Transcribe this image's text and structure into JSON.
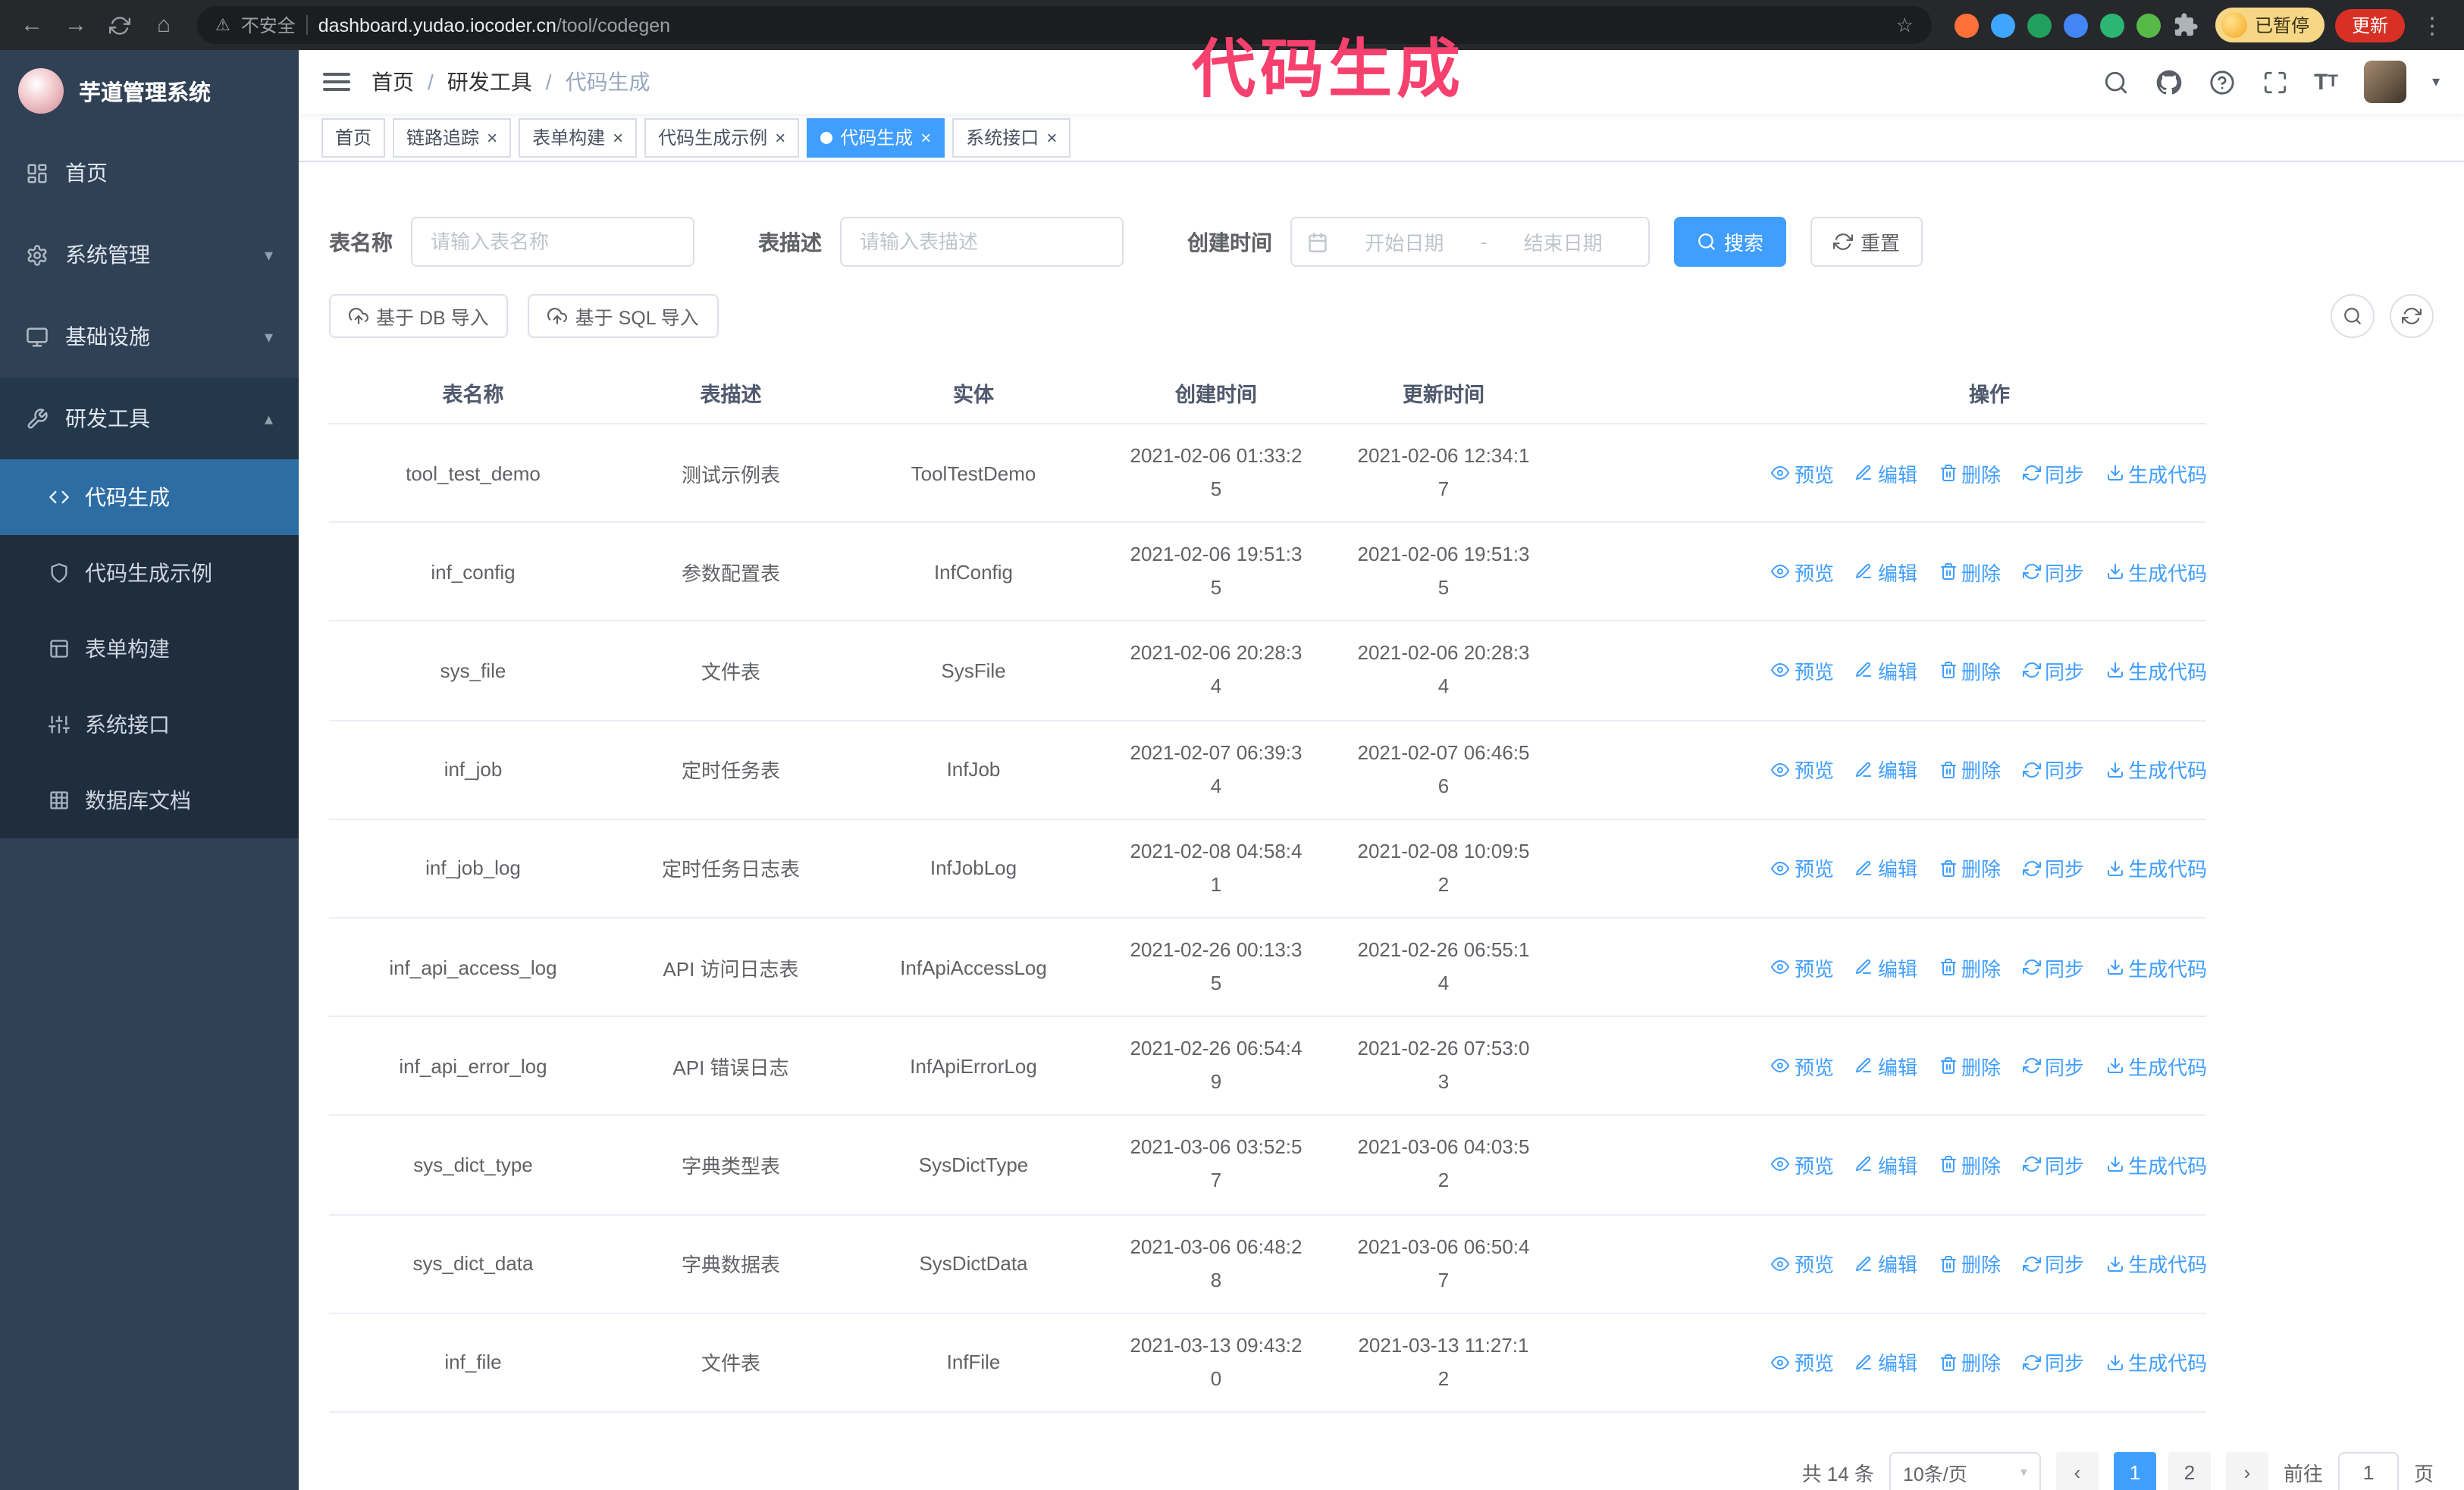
{
  "colors": {
    "primary": "#409eff",
    "sidebar_bg": "#304156",
    "overlay_text": "#f6406e"
  },
  "browser": {
    "security_label": "不安全",
    "url_host": "dashboard.yudao.iocoder.cn",
    "url_path": "/tool/codegen",
    "paused_badge": "已暂停",
    "update_button": "更新",
    "extensions": [
      {
        "name": "fox-extension-icon",
        "color": "#ff7139",
        "type": "dot"
      },
      {
        "name": "drop-extension-icon",
        "color": "#3ea6ff",
        "type": "dot"
      },
      {
        "name": "check-extension-icon",
        "color": "#21a05d",
        "type": "dot"
      },
      {
        "name": "people-extension-icon",
        "color": "#4285f4",
        "type": "dot"
      },
      {
        "name": "stripes-extension-icon",
        "color": "#2bb673",
        "type": "dot"
      },
      {
        "name": "leaf-extension-icon",
        "color": "#57b947",
        "type": "dot"
      },
      {
        "name": "puzzle-extension-icon",
        "color": "#9aa0a6",
        "type": "puzzle"
      }
    ]
  },
  "overlay_title": {
    "text": "代码生成"
  },
  "sidebar": {
    "logo_title": "芋道管理系统",
    "items": [
      {
        "id": "home",
        "label": "首页",
        "icon": "home",
        "expandable": false,
        "expanded": false
      },
      {
        "id": "system",
        "label": "系统管理",
        "icon": "gear",
        "expandable": true,
        "expanded": false
      },
      {
        "id": "infra",
        "label": "基础设施",
        "icon": "monitor",
        "expandable": true,
        "expanded": false
      },
      {
        "id": "devtools",
        "label": "研发工具",
        "icon": "wrench",
        "expandable": true,
        "expanded": true
      }
    ],
    "submenu": [
      {
        "id": "codegen",
        "label": "代码生成",
        "icon": "code",
        "active": true
      },
      {
        "id": "codegen-demo",
        "label": "代码生成示例",
        "icon": "shield",
        "active": false
      },
      {
        "id": "form-builder",
        "label": "表单构建",
        "icon": "form",
        "active": false
      },
      {
        "id": "api",
        "label": "系统接口",
        "icon": "api",
        "active": false
      },
      {
        "id": "db-doc",
        "label": "数据库文档",
        "icon": "db",
        "active": false
      }
    ]
  },
  "header": {
    "breadcrumb": [
      "首页",
      "研发工具",
      "代码生成"
    ]
  },
  "tabs": [
    {
      "id": "home",
      "label": "首页",
      "closable": false,
      "active": false
    },
    {
      "id": "tracing",
      "label": "链路追踪",
      "closable": true,
      "active": false
    },
    {
      "id": "form-builder",
      "label": "表单构建",
      "closable": true,
      "active": false
    },
    {
      "id": "codegen-demo",
      "label": "代码生成示例",
      "closable": true,
      "active": false
    },
    {
      "id": "codegen",
      "label": "代码生成",
      "closable": true,
      "active": true
    },
    {
      "id": "api",
      "label": "系统接口",
      "closable": true,
      "active": false
    }
  ],
  "filters": {
    "table_name_label": "表名称",
    "table_name_placeholder": "请输入表名称",
    "table_desc_label": "表描述",
    "table_desc_placeholder": "请输入表描述",
    "create_time_label": "创建时间",
    "date_start_placeholder": "开始日期",
    "date_separator": "-",
    "date_end_placeholder": "结束日期",
    "search_button": "搜索",
    "reset_button": "重置"
  },
  "toolbar": {
    "import_db_button": "基于 DB 导入",
    "import_sql_button": "基于 SQL 导入"
  },
  "table": {
    "columns": [
      "表名称",
      "表描述",
      "实体",
      "创建时间",
      "更新时间",
      "操作"
    ],
    "actions": [
      {
        "id": "preview",
        "label": "预览",
        "icon": "eye"
      },
      {
        "id": "edit",
        "label": "编辑",
        "icon": "edit"
      },
      {
        "id": "delete",
        "label": "删除",
        "icon": "trash"
      },
      {
        "id": "sync",
        "label": "同步",
        "icon": "sync"
      },
      {
        "id": "generate",
        "label": "生成代码",
        "icon": "download"
      }
    ],
    "rows": [
      {
        "name": "tool_test_demo",
        "desc": "测试示例表",
        "entity": "ToolTestDemo",
        "created": "2021-02-06 01:33:25",
        "updated": "2021-02-06 12:34:17"
      },
      {
        "name": "inf_config",
        "desc": "参数配置表",
        "entity": "InfConfig",
        "created": "2021-02-06 19:51:35",
        "updated": "2021-02-06 19:51:35"
      },
      {
        "name": "sys_file",
        "desc": "文件表",
        "entity": "SysFile",
        "created": "2021-02-06 20:28:34",
        "updated": "2021-02-06 20:28:34"
      },
      {
        "name": "inf_job",
        "desc": "定时任务表",
        "entity": "InfJob",
        "created": "2021-02-07 06:39:34",
        "updated": "2021-02-07 06:46:56"
      },
      {
        "name": "inf_job_log",
        "desc": "定时任务日志表",
        "entity": "InfJobLog",
        "created": "2021-02-08 04:58:41",
        "updated": "2021-02-08 10:09:52"
      },
      {
        "name": "inf_api_access_log",
        "desc": "API 访问日志表",
        "entity": "InfApiAccessLog",
        "created": "2021-02-26 00:13:35",
        "updated": "2021-02-26 06:55:14"
      },
      {
        "name": "inf_api_error_log",
        "desc": "API 错误日志",
        "entity": "InfApiErrorLog",
        "created": "2021-02-26 06:54:49",
        "updated": "2021-02-26 07:53:03"
      },
      {
        "name": "sys_dict_type",
        "desc": "字典类型表",
        "entity": "SysDictType",
        "created": "2021-03-06 03:52:57",
        "updated": "2021-03-06 04:03:52"
      },
      {
        "name": "sys_dict_data",
        "desc": "字典数据表",
        "entity": "SysDictData",
        "created": "2021-03-06 06:48:28",
        "updated": "2021-03-06 06:50:47"
      },
      {
        "name": "inf_file",
        "desc": "文件表",
        "entity": "InfFile",
        "created": "2021-03-13 09:43:20",
        "updated": "2021-03-13 11:27:12"
      }
    ]
  },
  "pagination": {
    "total_text": "共 14 条",
    "page_size": "10条/页",
    "pages": [
      "1",
      "2"
    ],
    "active_page": "1",
    "goto_label": "前往",
    "goto_value": "1",
    "goto_suffix": "页"
  }
}
